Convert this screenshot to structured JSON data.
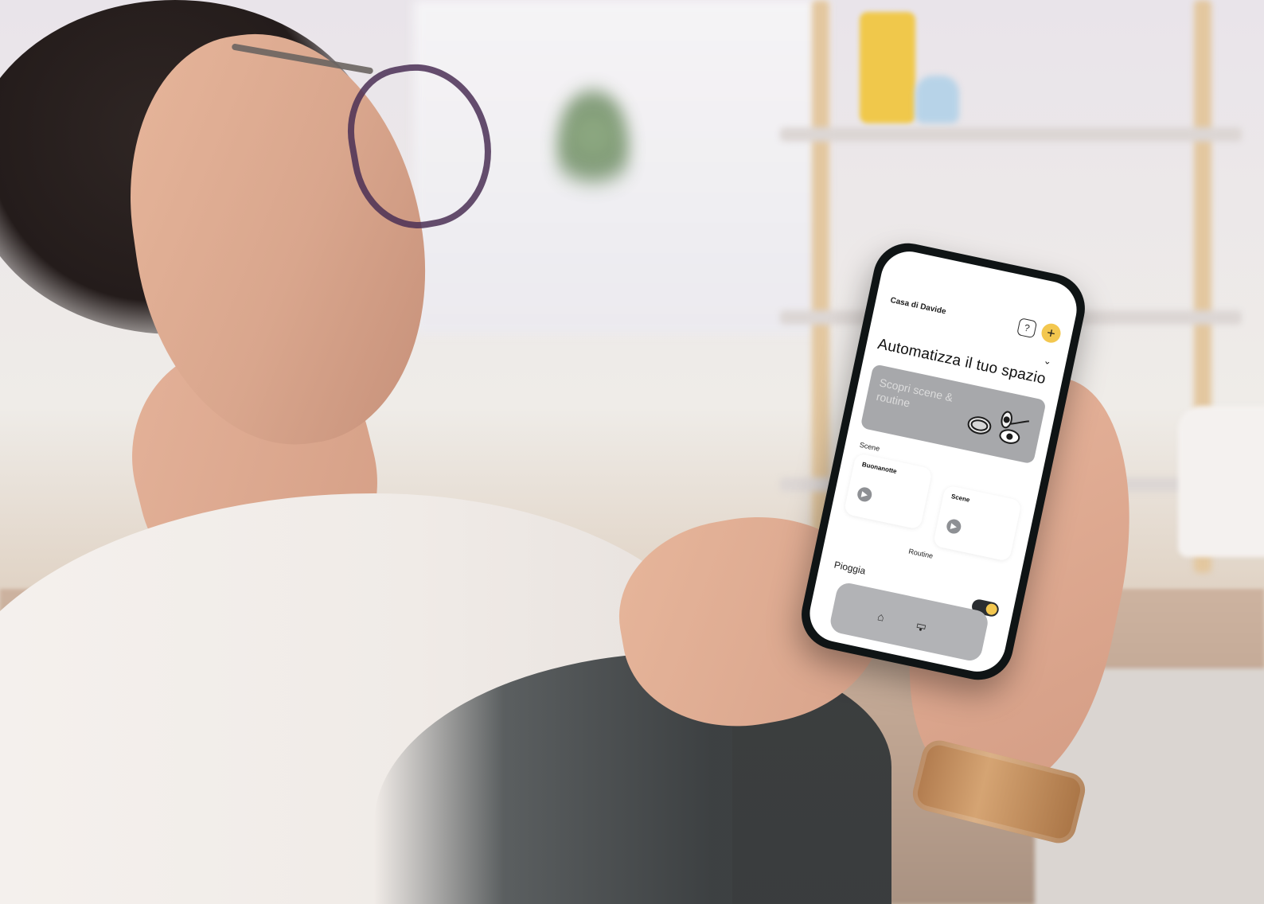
{
  "app": {
    "home_name": "Casa di Davide",
    "headline": "Automatizza il tuo spazio",
    "help_icon_label": "?",
    "add_icon_label": "+",
    "banner_text": "Scopri scene & routine",
    "sections": {
      "scenes_label": "Scene",
      "routines_label": "Routine"
    },
    "scene_cards": [
      {
        "title": "Buonanotte"
      },
      {
        "title": "Scene"
      }
    ],
    "routines": [
      {
        "name": "Pioggia",
        "enabled": true
      }
    ],
    "bottom_nav": [
      {
        "icon": "home-icon"
      },
      {
        "icon": "routines-icon"
      }
    ],
    "colors": {
      "accent": "#f3c74f",
      "card_gray": "#a7a8ab",
      "nav_gray": "#b2b3b6"
    }
  }
}
